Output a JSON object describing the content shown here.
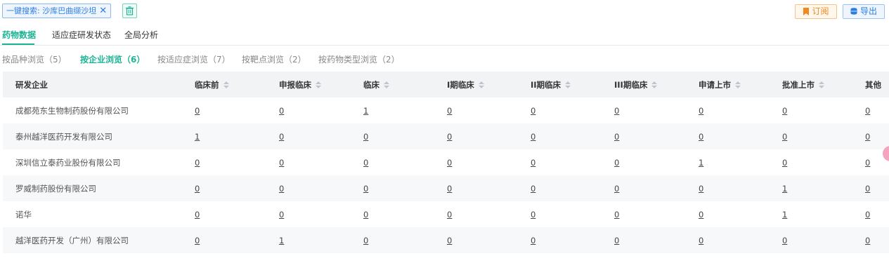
{
  "toolbar": {
    "search_tag_label": "一键搜索: 沙库巴曲缬沙坦",
    "search_tag_close": "✕",
    "subscribe_label": "订阅",
    "export_label": "导出"
  },
  "main_tabs": [
    {
      "label": "药物数据",
      "active": true
    },
    {
      "label": "适应症研发状态",
      "active": false
    },
    {
      "label": "全局分析",
      "active": false
    }
  ],
  "sub_tabs": [
    {
      "label": "按品种浏览（5）",
      "active": false
    },
    {
      "label": "按企业浏览（6）",
      "active": true
    },
    {
      "label": "按适应症浏览（7）",
      "active": false
    },
    {
      "label": "按靶点浏览（2）",
      "active": false
    },
    {
      "label": "按药物类型浏览（2）",
      "active": false
    }
  ],
  "table": {
    "headers": [
      "研发企业",
      "临床前",
      "申报临床",
      "临床",
      "I期临床",
      "II期临床",
      "III期临床",
      "申请上市",
      "批准上市",
      "其他"
    ],
    "rows": [
      {
        "company": "成都苑东生物制药股份有限公司",
        "values": [
          "0",
          "0",
          "1",
          "0",
          "0",
          "0",
          "0",
          "0",
          "0"
        ]
      },
      {
        "company": "泰州越洋医药开发有限公司",
        "values": [
          "1",
          "0",
          "0",
          "0",
          "0",
          "0",
          "0",
          "0",
          "0"
        ]
      },
      {
        "company": "深圳信立泰药业股份有限公司",
        "values": [
          "0",
          "0",
          "0",
          "0",
          "0",
          "0",
          "1",
          "0",
          "0"
        ]
      },
      {
        "company": "罗威制药股份有限公司",
        "values": [
          "0",
          "0",
          "0",
          "0",
          "0",
          "0",
          "0",
          "1",
          "0"
        ]
      },
      {
        "company": "诺华",
        "values": [
          "0",
          "0",
          "0",
          "0",
          "0",
          "0",
          "0",
          "1",
          "0"
        ]
      },
      {
        "company": "越洋医药开发（广州）有限公司",
        "values": [
          "0",
          "1",
          "0",
          "0",
          "0",
          "0",
          "0",
          "0",
          "0"
        ]
      }
    ]
  },
  "colors": {
    "accent": "#1bb394",
    "subscribe": "#f08a1c",
    "export": "#2b7de0",
    "header_bg": "#f2f3f5"
  }
}
